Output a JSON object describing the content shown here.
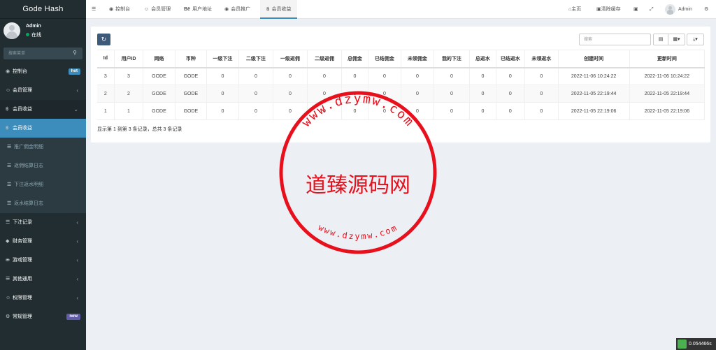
{
  "app": {
    "title": "Gode Hash"
  },
  "user": {
    "name": "Admin",
    "status": "在线"
  },
  "sidebar": {
    "search_placeholder": "搜索菜单",
    "items": [
      {
        "label": "控制台",
        "badge": "hot"
      },
      {
        "label": "会员管理"
      },
      {
        "label": "会员收益"
      },
      {
        "label": "会员收益"
      },
      {
        "label": "推广佣金明细"
      },
      {
        "label": "返佣结算日志"
      },
      {
        "label": "下注返水明细"
      },
      {
        "label": "返水结算日志"
      },
      {
        "label": "下注记录"
      },
      {
        "label": "财务管理"
      },
      {
        "label": "游戏管理"
      },
      {
        "label": "其他通用"
      },
      {
        "label": "权限管理"
      },
      {
        "label": "常规管理",
        "badge": "new"
      }
    ]
  },
  "topbar": {
    "tabs": [
      {
        "label": "控制台"
      },
      {
        "label": "会员管理"
      },
      {
        "label": "用户地址"
      },
      {
        "label": "会员推广"
      },
      {
        "label": "会员收益"
      }
    ],
    "home": "主页",
    "clear_cache": "清除缓存",
    "username": "Admin"
  },
  "toolbar": {
    "search_placeholder": "搜索"
  },
  "table": {
    "columns": [
      "Id",
      "用户ID",
      "网络",
      "币种",
      "一级下注",
      "二级下注",
      "一级返佣",
      "二级返佣",
      "总佣金",
      "已结佣金",
      "未领佣金",
      "我的下注",
      "总返水",
      "已结返水",
      "未领返水",
      "创建时间",
      "更新时间"
    ],
    "rows": [
      [
        "3",
        "3",
        "GODE",
        "GODE",
        "0",
        "0",
        "0",
        "0",
        "0",
        "0",
        "0",
        "0",
        "0",
        "0",
        "0",
        "2022-11-06 10:24:22",
        "2022-11-06 10:24:22"
      ],
      [
        "2",
        "2",
        "GODE",
        "GODE",
        "0",
        "0",
        "0",
        "0",
        "0",
        "0",
        "0",
        "0",
        "0",
        "0",
        "0",
        "2022-11-05 22:19:44",
        "2022-11-05 22:19:44"
      ],
      [
        "1",
        "1",
        "GODE",
        "GODE",
        "0",
        "0",
        "0",
        "0",
        "0",
        "0",
        "0",
        "0",
        "0",
        "0",
        "0",
        "2022-11-05 22:19:06",
        "2022-11-05 22:19:06"
      ]
    ],
    "footer": "显示第 1 到第 3 条记录，总共 3 条记录"
  },
  "watermark": {
    "center": "道臻源码网",
    "top_ring": "www.dzymw.com",
    "bottom_ring": "www.dzymw.com",
    "color": "#e8101c"
  },
  "perf": {
    "time": "0.054466s"
  },
  "colors": {
    "sidebar": "#222d32",
    "active": "#3c8dbc",
    "header": "#ffffff"
  }
}
